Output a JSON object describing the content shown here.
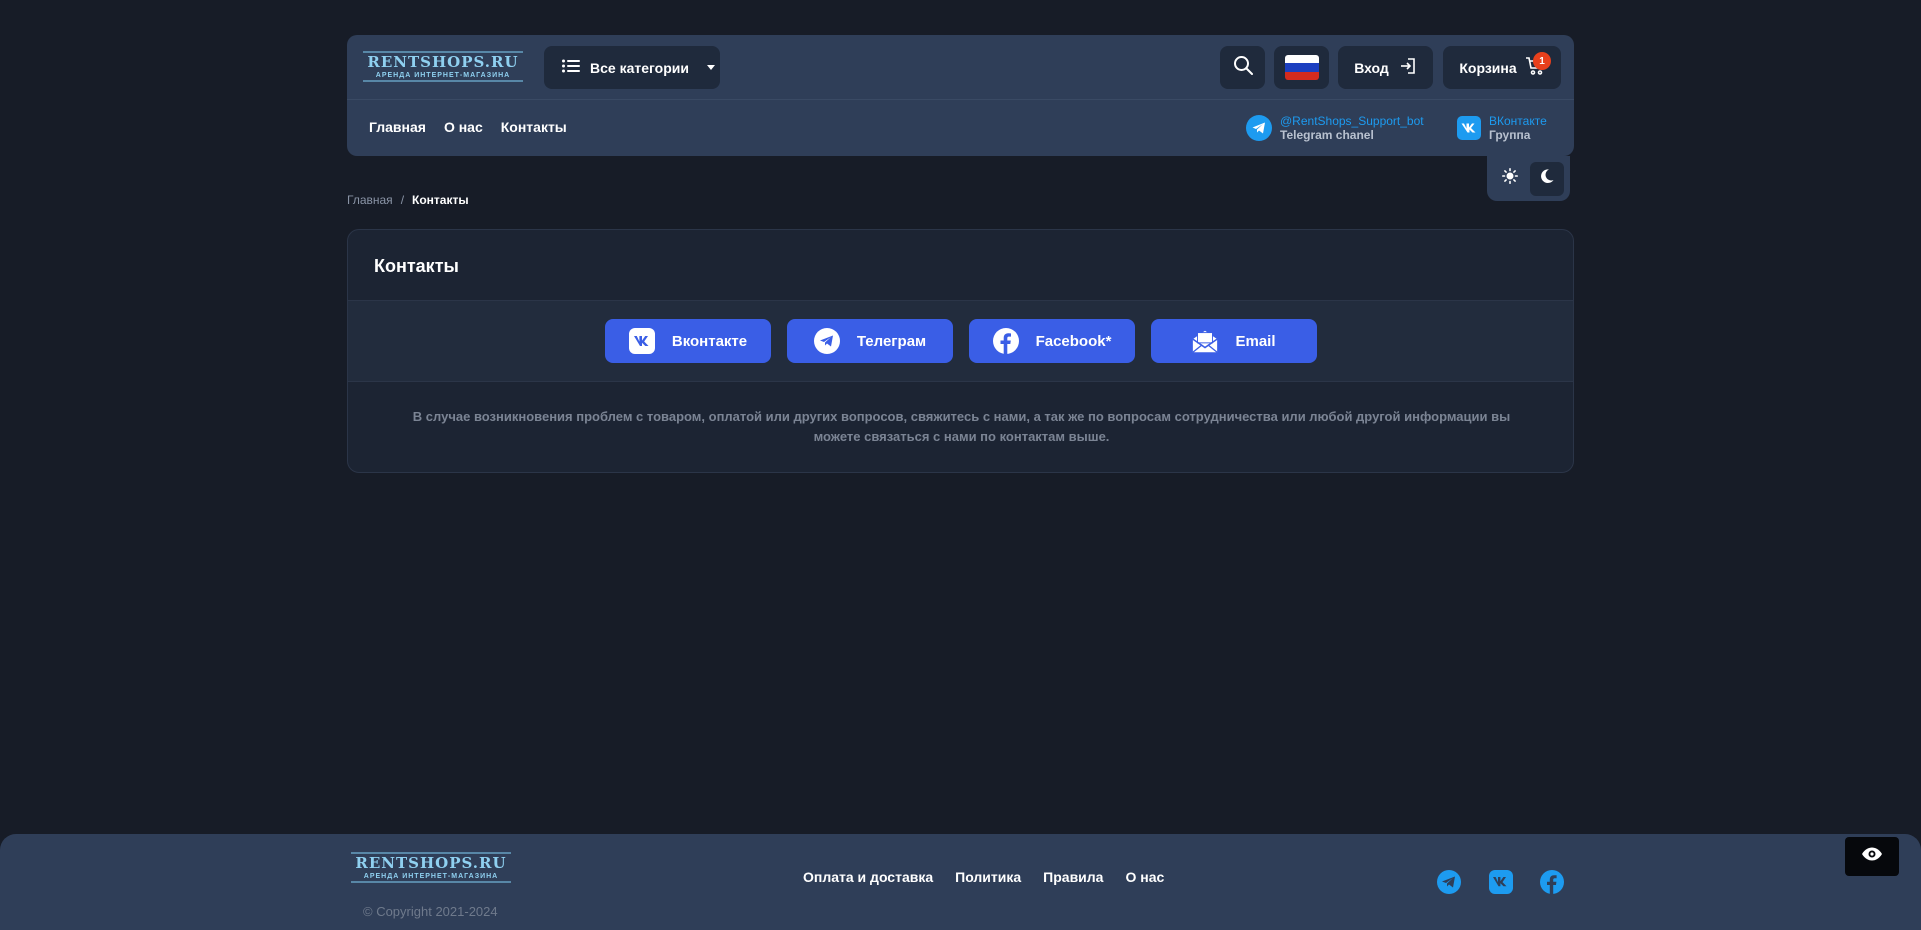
{
  "logo": {
    "main": "RENTSHOPS.RU",
    "sub": "АРЕНДА ИНТЕРНЕТ-МАГАЗИНА"
  },
  "header": {
    "categories_label": "Все категории",
    "login_label": "Вход",
    "cart_label": "Корзина",
    "cart_count": "1",
    "nav": [
      "Главная",
      "О нас",
      "Контакты"
    ],
    "telegram": {
      "handle": "@RentShops_Support_bot",
      "caption": "Telegram chanel"
    },
    "vk": {
      "title": "ВКонтакте",
      "caption": "Группа"
    }
  },
  "breadcrumb": {
    "home": "Главная",
    "separator": "/",
    "current": "Контакты"
  },
  "card": {
    "title": "Контакты",
    "buttons": [
      "Вконтакте",
      "Телеграм",
      "Facebook*",
      "Email"
    ],
    "text": "В случае возникновения проблем с товаром, оплатой или других вопросов, свяжитесь с нами, а так же по вопросам сотрудничества или любой другой информации вы можете связаться с нами по контактам выше."
  },
  "footer": {
    "copyright": "© Copyright 2021-2024",
    "nav": [
      "Оплата и доставка",
      "Политика",
      "Правила",
      "О нас"
    ]
  },
  "colors": {
    "background": "#171c27",
    "panel": "#2f3e58",
    "accent_button": "#3a5ee6",
    "link": "#1d9bf0",
    "badge": "#e8401c"
  },
  "icons": {
    "categories": "list-icon",
    "search": "search-icon",
    "language": "russia-flag-icon",
    "login": "login-icon",
    "cart": "cart-icon",
    "theme_light": "sun-icon",
    "theme_dark": "moon-icon",
    "accessibility": "eye-icon"
  }
}
